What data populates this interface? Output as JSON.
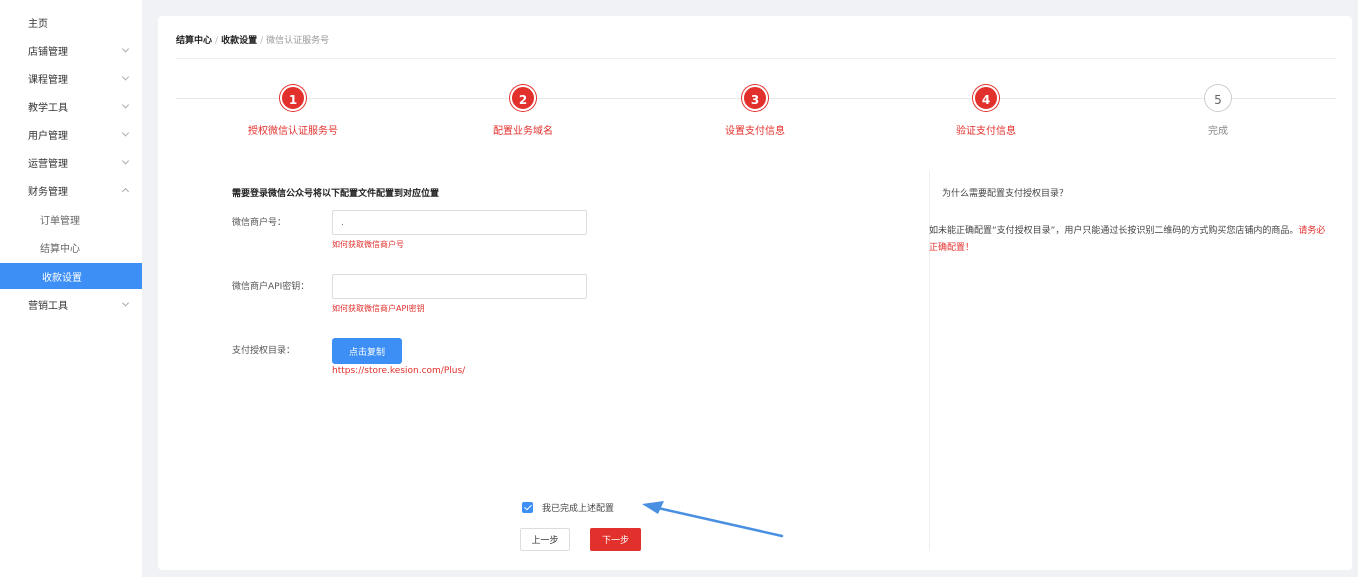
{
  "sidebar": {
    "items": [
      {
        "label": "主页"
      },
      {
        "label": "店铺管理"
      },
      {
        "label": "课程管理"
      },
      {
        "label": "教学工具"
      },
      {
        "label": "用户管理"
      },
      {
        "label": "运营管理"
      },
      {
        "label": "财务管理"
      },
      {
        "label": "订单管理"
      },
      {
        "label": "结算中心"
      },
      {
        "label": "收款设置"
      },
      {
        "label": "营销工具"
      }
    ]
  },
  "breadcrumb": {
    "level1": "结算中心",
    "sep": "/",
    "level2": "收款设置",
    "level3": "微信认证服务号"
  },
  "steps": [
    {
      "num": "1",
      "label": "授权微信认证服务号"
    },
    {
      "num": "2",
      "label": "配置业务域名"
    },
    {
      "num": "3",
      "label": "设置支付信息"
    },
    {
      "num": "4",
      "label": "验证支付信息"
    },
    {
      "num": "5",
      "label": "完成"
    }
  ],
  "form": {
    "title": "需要登录微信公众号将以下配置文件配置到对应位置",
    "merchant_id_label": "微信商户号：",
    "merchant_id_value": ".",
    "merchant_id_help": "如何获取微信商户号",
    "api_key_label": "微信商户API密钥：",
    "api_key_value": "",
    "api_key_help": "如何获取微信商户API密钥",
    "pay_dir_label": "支付授权目录：",
    "copy_button": "点击复制",
    "pay_dir_url": "https://store.kesion.com/Plus/"
  },
  "info": {
    "title": "为什么需要配置支付授权目录？",
    "body": "如未能正确配置“支付授权目录”，用户只能通过长按识别二维码的方式购买您店铺内的商品。",
    "warning": "请务必正确配置！"
  },
  "actions": {
    "confirm_label": "我已完成上述配置",
    "prev_button": "上一步",
    "next_button": "下一步"
  },
  "colors": {
    "accent_red": "#e2302c",
    "accent_blue": "#3d8ff5"
  }
}
